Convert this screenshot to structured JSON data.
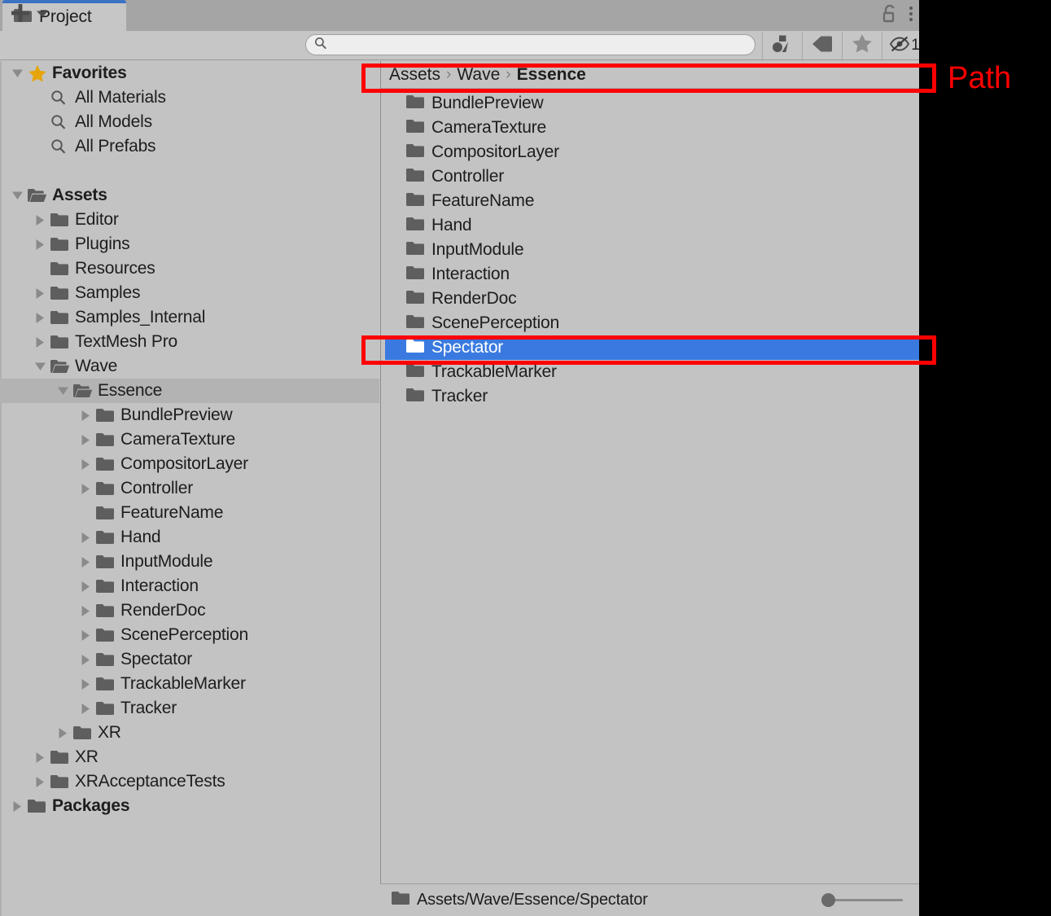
{
  "window": {
    "tab_label": "Project",
    "tab_icon": "folder-icon",
    "lock_icon": "padlock-open-icon",
    "menu_icon": "kebab-menu-icon"
  },
  "toolbar": {
    "create_label": "+",
    "create_dropdown_icon": "chevron-down-icon",
    "search": {
      "value": "",
      "placeholder": "",
      "icon": "search-icon"
    },
    "filters": [
      {
        "name": "asset-type-filter",
        "icon": "shapes-icon"
      },
      {
        "name": "label-filter",
        "icon": "tag-icon"
      },
      {
        "name": "favorites-filter",
        "icon": "star-icon"
      },
      {
        "name": "hidden-packages-filter",
        "icon": "eye-off-icon",
        "count": "1"
      }
    ]
  },
  "tree": [
    {
      "label": "Favorites",
      "depth": 0,
      "icon": "star-icon",
      "arrow": "down",
      "bold": true,
      "selected": false
    },
    {
      "label": "All Materials",
      "depth": 1,
      "icon": "search-icon",
      "arrow": "none",
      "bold": false,
      "selected": false
    },
    {
      "label": "All Models",
      "depth": 1,
      "icon": "search-icon",
      "arrow": "none",
      "bold": false,
      "selected": false
    },
    {
      "label": "All Prefabs",
      "depth": 1,
      "icon": "search-icon",
      "arrow": "none",
      "bold": false,
      "selected": false
    },
    {
      "label": "",
      "depth": 0,
      "icon": "none",
      "arrow": "none",
      "bold": false,
      "selected": false
    },
    {
      "label": "Assets",
      "depth": 0,
      "icon": "folder-open-icon",
      "arrow": "down",
      "bold": true,
      "selected": false
    },
    {
      "label": "Editor",
      "depth": 1,
      "icon": "folder-icon",
      "arrow": "right",
      "bold": false,
      "selected": false
    },
    {
      "label": "Plugins",
      "depth": 1,
      "icon": "folder-icon",
      "arrow": "right",
      "bold": false,
      "selected": false
    },
    {
      "label": "Resources",
      "depth": 1,
      "icon": "folder-icon",
      "arrow": "none",
      "bold": false,
      "selected": false
    },
    {
      "label": "Samples",
      "depth": 1,
      "icon": "folder-icon",
      "arrow": "right",
      "bold": false,
      "selected": false
    },
    {
      "label": "Samples_Internal",
      "depth": 1,
      "icon": "folder-icon",
      "arrow": "right",
      "bold": false,
      "selected": false
    },
    {
      "label": "TextMesh Pro",
      "depth": 1,
      "icon": "folder-icon",
      "arrow": "right",
      "bold": false,
      "selected": false
    },
    {
      "label": "Wave",
      "depth": 1,
      "icon": "folder-open-icon",
      "arrow": "down",
      "bold": false,
      "selected": false
    },
    {
      "label": "Essence",
      "depth": 2,
      "icon": "folder-open-icon",
      "arrow": "down",
      "bold": false,
      "selected": true
    },
    {
      "label": "BundlePreview",
      "depth": 3,
      "icon": "folder-icon",
      "arrow": "right",
      "bold": false,
      "selected": false
    },
    {
      "label": "CameraTexture",
      "depth": 3,
      "icon": "folder-icon",
      "arrow": "right",
      "bold": false,
      "selected": false
    },
    {
      "label": "CompositorLayer",
      "depth": 3,
      "icon": "folder-icon",
      "arrow": "right",
      "bold": false,
      "selected": false
    },
    {
      "label": "Controller",
      "depth": 3,
      "icon": "folder-icon",
      "arrow": "right",
      "bold": false,
      "selected": false
    },
    {
      "label": "FeatureName",
      "depth": 3,
      "icon": "folder-icon",
      "arrow": "none",
      "bold": false,
      "selected": false
    },
    {
      "label": "Hand",
      "depth": 3,
      "icon": "folder-icon",
      "arrow": "right",
      "bold": false,
      "selected": false
    },
    {
      "label": "InputModule",
      "depth": 3,
      "icon": "folder-icon",
      "arrow": "right",
      "bold": false,
      "selected": false
    },
    {
      "label": "Interaction",
      "depth": 3,
      "icon": "folder-icon",
      "arrow": "right",
      "bold": false,
      "selected": false
    },
    {
      "label": "RenderDoc",
      "depth": 3,
      "icon": "folder-icon",
      "arrow": "right",
      "bold": false,
      "selected": false
    },
    {
      "label": "ScenePerception",
      "depth": 3,
      "icon": "folder-icon",
      "arrow": "right",
      "bold": false,
      "selected": false
    },
    {
      "label": "Spectator",
      "depth": 3,
      "icon": "folder-icon",
      "arrow": "right",
      "bold": false,
      "selected": false
    },
    {
      "label": "TrackableMarker",
      "depth": 3,
      "icon": "folder-icon",
      "arrow": "right",
      "bold": false,
      "selected": false
    },
    {
      "label": "Tracker",
      "depth": 3,
      "icon": "folder-icon",
      "arrow": "right",
      "bold": false,
      "selected": false
    },
    {
      "label": "XR",
      "depth": 2,
      "icon": "folder-icon",
      "arrow": "right",
      "bold": false,
      "selected": false
    },
    {
      "label": "XR",
      "depth": 1,
      "icon": "folder-icon",
      "arrow": "right",
      "bold": false,
      "selected": false
    },
    {
      "label": "XRAcceptanceTests",
      "depth": 1,
      "icon": "folder-icon",
      "arrow": "right",
      "bold": false,
      "selected": false
    },
    {
      "label": "Packages",
      "depth": 0,
      "icon": "folder-icon",
      "arrow": "right",
      "bold": true,
      "selected": false
    }
  ],
  "breadcrumb": [
    {
      "label": "Assets",
      "current": false
    },
    {
      "label": "Wave",
      "current": false
    },
    {
      "label": "Essence",
      "current": true
    }
  ],
  "breadcrumb_separator": "›",
  "content_items": [
    {
      "label": "BundlePreview",
      "selected": false
    },
    {
      "label": "CameraTexture",
      "selected": false
    },
    {
      "label": "CompositorLayer",
      "selected": false
    },
    {
      "label": "Controller",
      "selected": false
    },
    {
      "label": "FeatureName",
      "selected": false
    },
    {
      "label": "Hand",
      "selected": false
    },
    {
      "label": "InputModule",
      "selected": false
    },
    {
      "label": "Interaction",
      "selected": false
    },
    {
      "label": "RenderDoc",
      "selected": false
    },
    {
      "label": "ScenePerception",
      "selected": false
    },
    {
      "label": "Spectator",
      "selected": true
    },
    {
      "label": "TrackableMarker",
      "selected": false
    },
    {
      "label": "Tracker",
      "selected": false
    }
  ],
  "statusbar": {
    "path": "Assets/Wave/Essence/Spectator",
    "icon": "folder-icon",
    "zoom_value": 0
  },
  "annotations": [
    {
      "label": "Path",
      "type": "label"
    }
  ],
  "colors": {
    "background": "#c3c3c3",
    "tab_active": "#c6c6c6",
    "tab_accent": "#3a72c4",
    "selection_blue": "#3a7ae0",
    "tree_selection_gray": "#b3b3b3",
    "annotation_red": "#ff0000",
    "favorite_star": "#e5a50a",
    "folder_gray": "#5e5e5e",
    "text": "#1d1d1d"
  }
}
